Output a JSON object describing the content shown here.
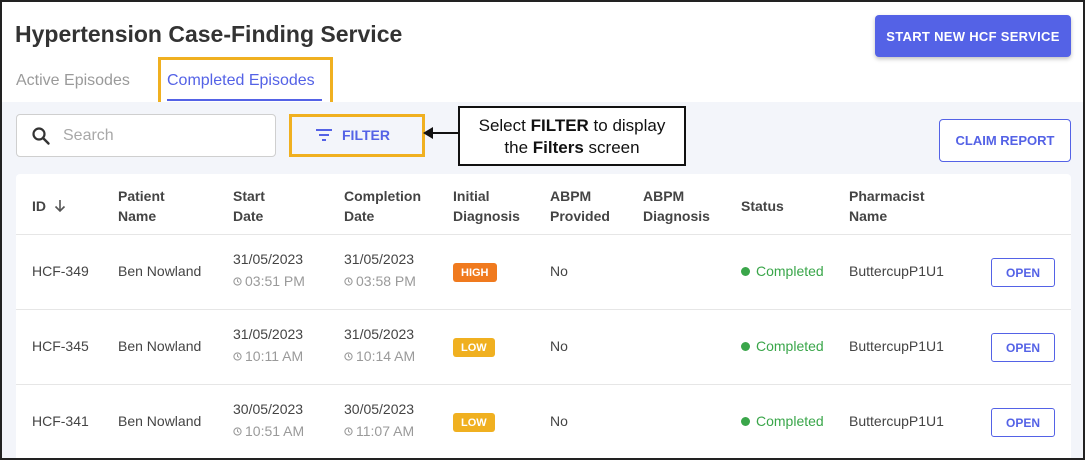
{
  "header": {
    "title": "Hypertension Case-Finding Service",
    "start_button": "START NEW HCF SERVICE",
    "tabs": [
      {
        "label": "Active Episodes"
      },
      {
        "label": "Completed Episodes"
      }
    ]
  },
  "toolbar": {
    "search_placeholder": "Search",
    "filter_label": "FILTER",
    "claim_label": "CLAIM REPORT"
  },
  "callout": {
    "prefix": "Select ",
    "bold1": "FILTER",
    "middle": " to display",
    "line2_prefix": "the ",
    "bold2": "Filters",
    "suffix": " screen"
  },
  "table": {
    "headers": {
      "id": "ID",
      "patient_1": "Patient",
      "patient_2": "Name",
      "start_1": "Start",
      "start_2": "Date",
      "completion_1": "Completion",
      "completion_2": "Date",
      "initial_1": "Initial",
      "initial_2": "Diagnosis",
      "abpm_prov_1": "ABPM",
      "abpm_prov_2": "Provided",
      "abpm_diag_1": "ABPM",
      "abpm_diag_2": "Diagnosis",
      "status": "Status",
      "pharm_1": "Pharmacist",
      "pharm_2": "Name"
    },
    "rows": [
      {
        "id": "HCF-349",
        "patient": "Ben Nowland",
        "start_date": "31/05/2023",
        "start_time": "03:51 PM",
        "completion_date": "31/05/2023",
        "completion_time": "03:58 PM",
        "diagnosis": "HIGH",
        "abpm_provided": "No",
        "abpm_diagnosis": "",
        "status": "Completed",
        "pharmacist": "ButtercupP1U1",
        "action": "OPEN"
      },
      {
        "id": "HCF-345",
        "patient": "Ben Nowland",
        "start_date": "31/05/2023",
        "start_time": "10:11 AM",
        "completion_date": "31/05/2023",
        "completion_time": "10:14 AM",
        "diagnosis": "LOW",
        "abpm_provided": "No",
        "abpm_diagnosis": "",
        "status": "Completed",
        "pharmacist": "ButtercupP1U1",
        "action": "OPEN"
      },
      {
        "id": "HCF-341",
        "patient": "Ben Nowland",
        "start_date": "30/05/2023",
        "start_time": "10:51 AM",
        "completion_date": "30/05/2023",
        "completion_time": "11:07 AM",
        "diagnosis": "LOW",
        "abpm_provided": "No",
        "abpm_diagnosis": "",
        "status": "Completed",
        "pharmacist": "ButtercupP1U1",
        "action": "OPEN"
      }
    ]
  },
  "colors": {
    "accent": "#5462e6",
    "highlight": "#f0b020",
    "high_badge": "#f07a1e",
    "low_badge": "#f0b020",
    "status_green": "#3aa64a"
  }
}
